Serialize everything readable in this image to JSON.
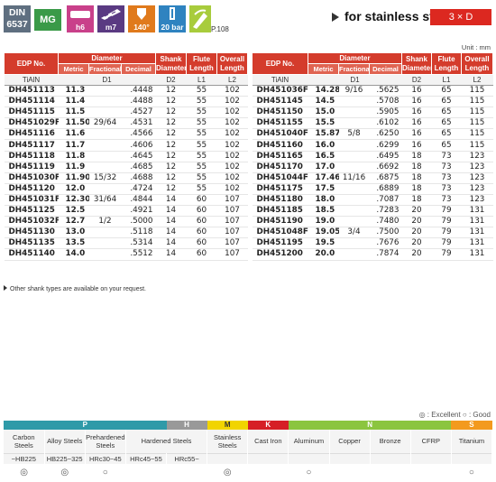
{
  "header": {
    "din_label": "DIN",
    "din_number": "6537",
    "material_badge": "MG",
    "icons": [
      {
        "name": "h6-shank-icon",
        "caption": "h6",
        "color": "#c9408a"
      },
      {
        "name": "m7-tolerance-icon",
        "caption": "m7",
        "color": "#5a3a82"
      },
      {
        "name": "point-angle-icon",
        "caption": "140°",
        "color": "#e07a1c"
      },
      {
        "name": "coolant-pressure-icon",
        "caption": "20 bar",
        "color": "#2f83c0"
      },
      {
        "name": "internal-coolant-icon",
        "caption": "",
        "color": "#a8cc3c"
      }
    ],
    "page_ref": "P.108",
    "title": "for stainless steel",
    "ratio": "3 × D",
    "accent_color": "#dc2820"
  },
  "unit": "Unit : mm",
  "columns": {
    "edp": "EDP No.",
    "diameter": "Diameter",
    "metric": "Metric",
    "fractional": "Fractional",
    "decimal": "Decimal",
    "shank": "Shank Diameter",
    "flute": "Flute Length",
    "overall": "Overall Length",
    "coating": "TiAlN",
    "d1": "D1",
    "d2": "D2",
    "l1": "L1",
    "l2": "L2"
  },
  "tables": [
    {
      "rows": [
        [
          "DH451113",
          "11.3",
          "",
          ".4448",
          "12",
          "55",
          "102"
        ],
        [
          "DH451114",
          "11.4",
          "",
          ".4488",
          "12",
          "55",
          "102"
        ],
        [
          "DH451115",
          "11.5",
          "",
          ".4527",
          "12",
          "55",
          "102"
        ],
        [
          "DH451029F",
          "11.509",
          "29/64",
          ".4531",
          "12",
          "55",
          "102"
        ],
        [
          "DH451116",
          "11.6",
          "",
          ".4566",
          "12",
          "55",
          "102"
        ],
        [
          "DH451117",
          "11.7",
          "",
          ".4606",
          "12",
          "55",
          "102"
        ],
        [
          "DH451118",
          "11.8",
          "",
          ".4645",
          "12",
          "55",
          "102"
        ],
        [
          "DH451119",
          "11.9",
          "",
          ".4685",
          "12",
          "55",
          "102"
        ],
        [
          "DH451030F",
          "11.906",
          "15/32",
          ".4688",
          "12",
          "55",
          "102"
        ],
        [
          "DH451120",
          "12.0",
          "",
          ".4724",
          "12",
          "55",
          "102"
        ],
        [
          "DH451031F",
          "12.303",
          "31/64",
          ".4844",
          "14",
          "60",
          "107"
        ],
        [
          "DH451125",
          "12.5",
          "",
          ".4921",
          "14",
          "60",
          "107"
        ],
        [
          "DH451032F",
          "12.7",
          "1/2",
          ".5000",
          "14",
          "60",
          "107"
        ],
        [
          "DH451130",
          "13.0",
          "",
          ".5118",
          "14",
          "60",
          "107"
        ],
        [
          "DH451135",
          "13.5",
          "",
          ".5314",
          "14",
          "60",
          "107"
        ],
        [
          "DH451140",
          "14.0",
          "",
          ".5512",
          "14",
          "60",
          "107"
        ]
      ]
    },
    {
      "rows": [
        [
          "DH451036F",
          "14.288",
          "9/16",
          ".5625",
          "16",
          "65",
          "115"
        ],
        [
          "DH451145",
          "14.5",
          "",
          ".5708",
          "16",
          "65",
          "115"
        ],
        [
          "DH451150",
          "15.0",
          "",
          ".5905",
          "16",
          "65",
          "115"
        ],
        [
          "DH451155",
          "15.5",
          "",
          ".6102",
          "16",
          "65",
          "115"
        ],
        [
          "DH451040F",
          "15.875",
          "5/8",
          ".6250",
          "16",
          "65",
          "115"
        ],
        [
          "DH451160",
          "16.0",
          "",
          ".6299",
          "16",
          "65",
          "115"
        ],
        [
          "DH451165",
          "16.5",
          "",
          ".6495",
          "18",
          "73",
          "123"
        ],
        [
          "DH451170",
          "17.0",
          "",
          ".6692",
          "18",
          "73",
          "123"
        ],
        [
          "DH451044F",
          "17.463",
          "11/16",
          ".6875",
          "18",
          "73",
          "123"
        ],
        [
          "DH451175",
          "17.5",
          "",
          ".6889",
          "18",
          "73",
          "123"
        ],
        [
          "DH451180",
          "18.0",
          "",
          ".7087",
          "18",
          "73",
          "123"
        ],
        [
          "DH451185",
          "18.5",
          "",
          ".7283",
          "20",
          "79",
          "131"
        ],
        [
          "DH451190",
          "19.0",
          "",
          ".7480",
          "20",
          "79",
          "131"
        ],
        [
          "DH451048F",
          "19.05",
          "3/4",
          ".7500",
          "20",
          "79",
          "131"
        ],
        [
          "DH451195",
          "19.5",
          "",
          ".7676",
          "20",
          "79",
          "131"
        ],
        [
          "DH451200",
          "20.0",
          "",
          ".7874",
          "20",
          "79",
          "131"
        ]
      ]
    }
  ],
  "note": "Other shank types are available on your request.",
  "legend": "◎ : Excellent    ○ : Good",
  "suitability": {
    "categories": [
      {
        "code": "P",
        "span": 4,
        "color": "#2f9aa8"
      },
      {
        "code": "H",
        "span": 1,
        "color": "#999999"
      },
      {
        "code": "M",
        "span": 1,
        "color": "#f1d400"
      },
      {
        "code": "K",
        "span": 1,
        "color": "#d61f26"
      },
      {
        "code": "N",
        "span": 4,
        "color": "#8bc53f"
      },
      {
        "code": "S",
        "span": 1,
        "color": "#f39a1e"
      }
    ],
    "materials": [
      {
        "label": "Carbon Steels",
        "hardness": "~HB225",
        "mark": "◎"
      },
      {
        "label": "Alloy Steels",
        "hardness": "HB225~325",
        "mark": "◎"
      },
      {
        "label": "Prehardened Steels",
        "hardness": "HRc30~45",
        "mark": "○"
      },
      {
        "label": "Hardened Steels",
        "hardness": "HRc45~55",
        "mark": ""
      },
      {
        "label": "",
        "hardness": "HRc55~",
        "mark": ""
      },
      {
        "label": "Stainless Steels",
        "hardness": "",
        "mark": "◎"
      },
      {
        "label": "Cast Iron",
        "hardness": "",
        "mark": ""
      },
      {
        "label": "Aluminum",
        "hardness": "",
        "mark": "○"
      },
      {
        "label": "Copper",
        "hardness": "",
        "mark": ""
      },
      {
        "label": "Bronze",
        "hardness": "",
        "mark": ""
      },
      {
        "label": "CFRP",
        "hardness": "",
        "mark": ""
      },
      {
        "label": "Titanium",
        "hardness": "",
        "mark": "○"
      }
    ]
  }
}
